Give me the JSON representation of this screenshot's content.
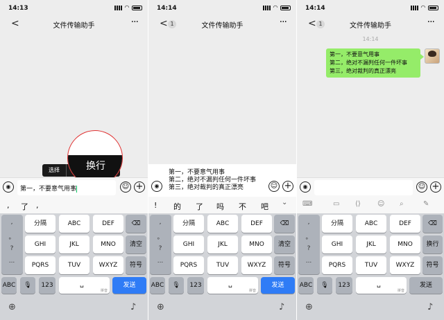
{
  "panels": [
    {
      "status_time": "14:13",
      "nav_back": "<",
      "nav_title": "文件传输助手",
      "nav_more": "···",
      "input_text": "第一，不要意气用事",
      "popup_select": "选择",
      "popup_newline": "换行",
      "candidates": [
        ",",
        "了",
        ","
      ]
    },
    {
      "status_time": "14:14",
      "nav_back": "<",
      "nav_badge": "1",
      "nav_title": "文件传输助手",
      "nav_more": "···",
      "message_lines": [
        "第一，不要意气用事",
        "第二，绝对不漏判任何一件坏事",
        "第三，绝对裁判的真正漂亮"
      ],
      "candidates": [
        "!",
        "的",
        "了",
        "吗",
        "不",
        "吧"
      ],
      "collapse_icon": "chevron-down"
    },
    {
      "status_time": "14:14",
      "nav_back": "<",
      "nav_badge": "1",
      "nav_title": "文件传输助手",
      "nav_more": "···",
      "timestamp": "14:14",
      "bubble_lines": [
        "第一，不要意气用事",
        "第二，绝对不漏判任何一件坏事",
        "第三，绝对裁判的真正漂亮"
      ],
      "toolbar_icons": [
        "keyboard-icon",
        "cursor-move-icon",
        "emoji-icon",
        "search-icon",
        "paint-icon"
      ]
    }
  ],
  "keyboard": {
    "symbols": [
      ",",
      "。",
      "?",
      "!",
      "..."
    ],
    "row1": [
      "分隔",
      "ABC",
      "DEF"
    ],
    "row2": [
      "GHI",
      "JKL",
      "MNO"
    ],
    "row3": [
      "PQRS",
      "TUV",
      "WXYZ"
    ],
    "right_keys": [
      "清空",
      "符号"
    ],
    "right_keys_p3": [
      "换行",
      "符号"
    ],
    "bottom_left": "ABC",
    "bottom_num": "123",
    "space_sub": "拼音",
    "send": "发送",
    "accent_color": "#2f7cf6",
    "bubble_color": "#95ec69"
  }
}
